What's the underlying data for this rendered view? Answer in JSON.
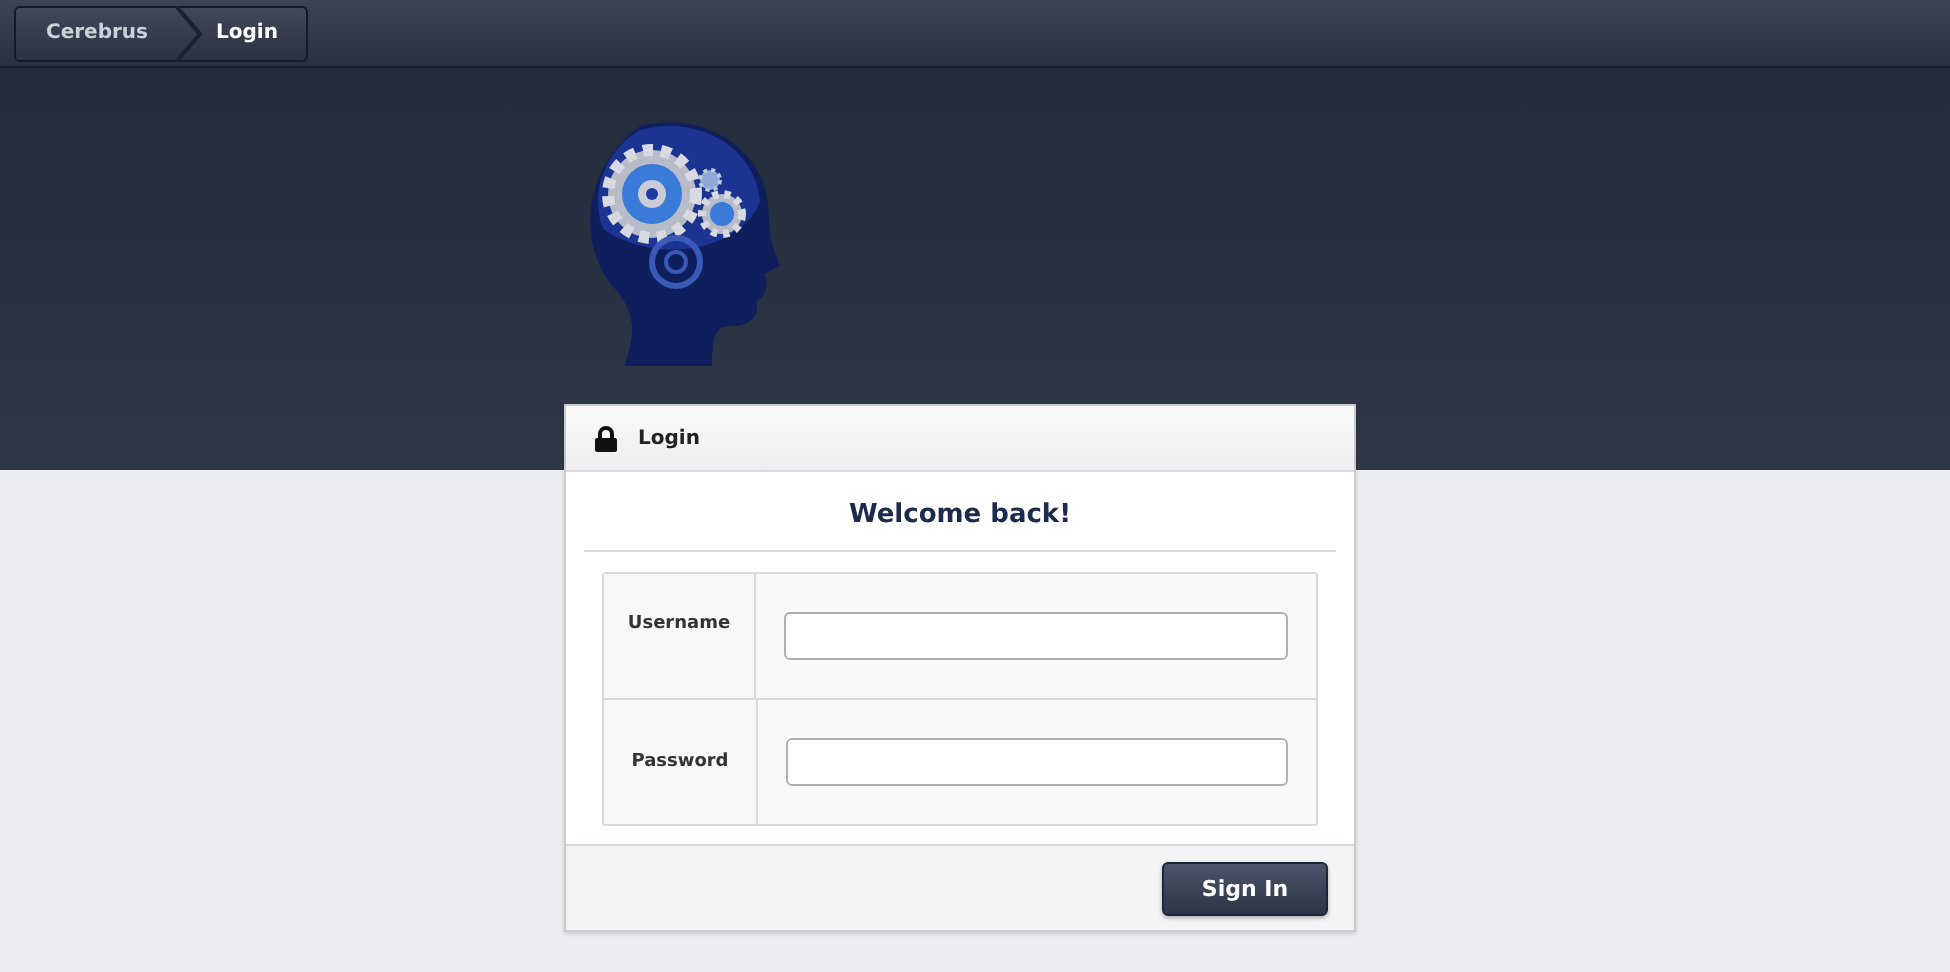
{
  "breadcrumb": [
    {
      "label": "Cerebrus",
      "selected": false
    },
    {
      "label": "Login",
      "selected": true
    }
  ],
  "login_panel": {
    "title": "Login",
    "heading": "Welcome back!",
    "fields": [
      {
        "label": "Username"
      },
      {
        "label": "Password"
      }
    ],
    "button": "Sign In"
  }
}
